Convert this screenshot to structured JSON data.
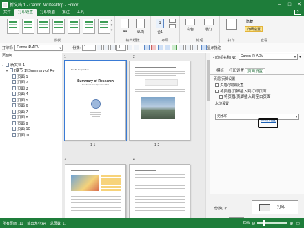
{
  "window": {
    "title": "新文档 1 - Canon iW Desktop - Editor",
    "min": "–",
    "max": "□",
    "close": "✕"
  },
  "menu": {
    "tabs": [
      "文件",
      "打印设置",
      "打印页眉",
      "批注",
      "工具"
    ],
    "active_index": 1
  },
  "ribbon": {
    "group_template": "模板",
    "group_output": "输出纸张",
    "group_layout": "布局",
    "group_finish": "处理",
    "group_print": "打印",
    "group_view": "查看",
    "paper_size": "A4",
    "orientation": "纵向",
    "layout_count": "1",
    "layout_label": "合1",
    "colormode": "彩色",
    "duplex": "单双面",
    "staple": "装订",
    "view_options": [
      "隐藏",
      "详细设置"
    ]
  },
  "toolbar": {
    "printer_label": "打印机:",
    "printer_value": "Canon iR-ADV",
    "copies_label": "份数:",
    "copies_value": "1",
    "page_input": "1",
    "show_comments": "显示批注"
  },
  "tree": {
    "header": "页面树",
    "root": "新文档 1",
    "chapter": "[章节 1] Summary of Re",
    "pages": [
      "页面 1",
      "页面 2",
      "页面 3",
      "页面 4",
      "页面 5",
      "页面 6",
      "页面 7",
      "页面 8",
      "页面 9",
      "页面 10",
      "页面 11"
    ]
  },
  "pages_view": {
    "group_nums": [
      "1",
      "2",
      "3",
      "4"
    ],
    "captions": [
      "1-1",
      "1-2"
    ],
    "p1_title": "Summary of Research",
    "p1_sub": "Results and Developments in 2020"
  },
  "settings": {
    "printer_label": "打印机名称(N):",
    "printer_value": "Canon iR-ADV",
    "tabs": [
      "模板",
      "打印设置",
      "页面设置"
    ],
    "active_tab": 2,
    "section_header": "页眉/页脚设置",
    "opts": [
      "页眉/页脚设置",
      "将页眉/页脚插入到打印页面",
      "将页眉/页脚插入到空白页面"
    ],
    "watermark_label": "水印设置",
    "watermark_value": "无水印",
    "detail_link": "详细设置",
    "copies_label": "份数(C):",
    "copies_value": "1",
    "print_button": "打印"
  },
  "status": {
    "total_pages": "所有页面: /11",
    "paper_size": "输出大小:A4",
    "page_count": "总页数: 11",
    "zoom": "25%"
  }
}
